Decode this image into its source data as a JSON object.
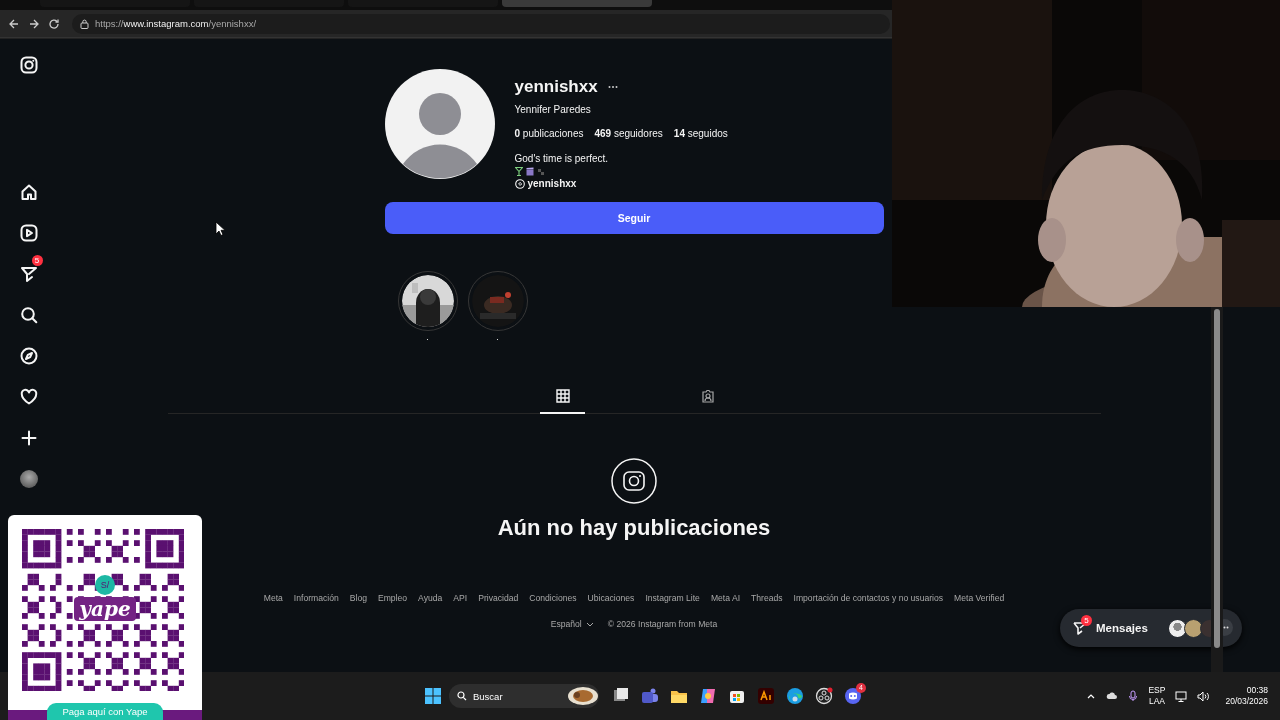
{
  "browser": {
    "tabs": [
      {
        "selected": false
      },
      {
        "selected": false
      },
      {
        "selected": false
      },
      {
        "selected": true
      }
    ],
    "url_scheme": "https://",
    "url_host": "www.instagram.com",
    "url_path": "/yennishxx/"
  },
  "sidebar": {
    "messages_badge": "5"
  },
  "profile": {
    "username": "yennishxx",
    "full_name": "Yennifer Paredes",
    "stats": [
      {
        "count": "0",
        "label": "publicaciones"
      },
      {
        "count": "469",
        "label": "seguidores"
      },
      {
        "count": "14",
        "label": "seguidos"
      }
    ],
    "bio": "God's time is perfect.",
    "threads_handle": "yennishxx",
    "follow_button": "Seguir"
  },
  "highlights": [
    {
      "title": "."
    },
    {
      "title": "."
    }
  ],
  "tabs": [
    {
      "kind": "grid",
      "selected": true
    },
    {
      "kind": "tagged",
      "selected": false
    }
  ],
  "empty_state": "Aún no hay publicaciones",
  "footer": {
    "links": [
      "Meta",
      "Información",
      "Blog",
      "Empleo",
      "Ayuda",
      "API",
      "Privacidad",
      "Condiciones",
      "Ubicaciones",
      "Instagram Lite",
      "Meta AI",
      "Threads",
      "Importación de contactos y no usuarios",
      "Meta Verified"
    ],
    "language": "Español",
    "copyright": "© 2026 Instagram from Meta"
  },
  "messages_bar": {
    "label": "Mensajes",
    "badge": "5"
  },
  "qr_card": {
    "currency": "S/",
    "logo": "yape",
    "caption": "Paga aquí con Yape"
  },
  "taskbar": {
    "search": "Buscar",
    "discord_badge": "4",
    "language": "ESP",
    "region": "LAA",
    "time": "00:38",
    "date": "20/03/2026"
  }
}
